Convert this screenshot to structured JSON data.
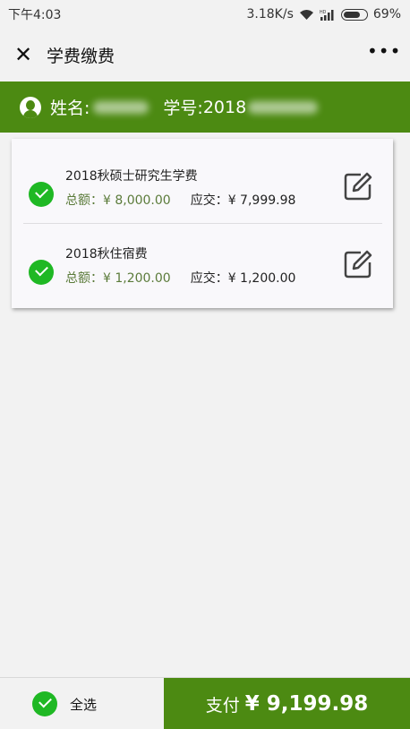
{
  "status_bar": {
    "time": "下午4:03",
    "net_speed": "3.18K/s",
    "battery": "69%",
    "signal_label": "HD"
  },
  "nav": {
    "close_glyph": "✕",
    "title": "学费缴费",
    "more_glyph": "•••"
  },
  "student": {
    "name_label": "姓名:",
    "id_label": "学号:",
    "id_prefix": "2018"
  },
  "fees": [
    {
      "name": "2018秋硕士研究生学费",
      "total": "总额：¥ 8,000.00",
      "due": "应交：¥ 7,999.98",
      "selected": true
    },
    {
      "name": "2018秋住宿费",
      "total": "总额：¥ 1,200.00",
      "due": "应交：¥ 1,200.00",
      "selected": true
    }
  ],
  "footer": {
    "select_all_label": "全选",
    "pay_label": "支付",
    "pay_amount": "¥ 9,199.98"
  },
  "colors": {
    "brand_green": "#4c8a12",
    "check_green": "#1fb824",
    "total_text": "#5b7b3a"
  }
}
